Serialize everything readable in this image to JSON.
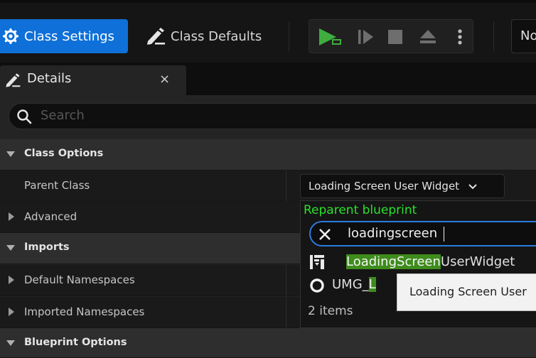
{
  "toolbar": {
    "class_settings_label": "Class Settings",
    "class_defaults_label": "Class Defaults",
    "dropdown_label": "No"
  },
  "details_tab": {
    "label": "Details",
    "close": "×"
  },
  "search": {
    "placeholder": "Search"
  },
  "rows": {
    "class_options": "Class Options",
    "parent_class_label": "Parent Class",
    "parent_class_value": "Loading Screen User Widget",
    "advanced": "Advanced",
    "imports": "Imports",
    "default_namespaces": "Default Namespaces",
    "imported_namespaces": "Imported Namespaces",
    "blueprint_options": "Blueprint Options"
  },
  "reparent": {
    "title": "Reparent blueprint",
    "search_value": "loadingscreen",
    "results": [
      {
        "match": "LoadingScreen",
        "rest": "UserWidget"
      },
      {
        "prefix": "UMG_",
        "match": "L"
      }
    ],
    "count": "2 items"
  },
  "tooltip": {
    "text": "Loading Screen User"
  },
  "colors": {
    "accent": "#0e70d8",
    "play_green": "#3fae3f",
    "highlight": "#3e8c1c",
    "reparent_title": "#2ce02c"
  },
  "icons": [
    "gear-icon",
    "pencil-icon",
    "play-icon",
    "step-icon",
    "stop-icon",
    "eject-icon",
    "more-icon",
    "search-icon",
    "clear-icon",
    "widget-class-icon",
    "class-circle-icon"
  ]
}
